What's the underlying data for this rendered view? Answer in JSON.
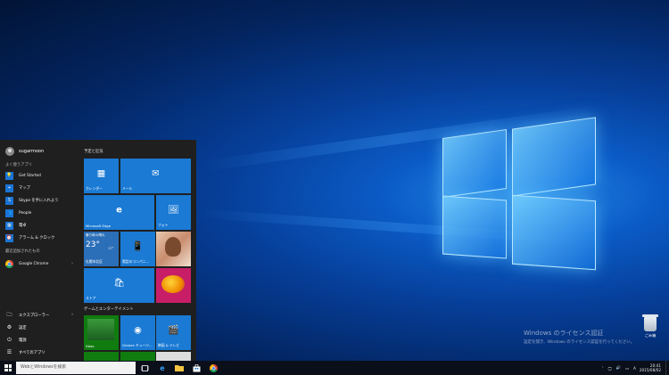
{
  "start_menu": {
    "user_name": "sugarmoon",
    "most_used_label": "よく使うアプリ",
    "most_used": [
      {
        "label": "Get Started",
        "icon": "lightbulb-icon",
        "glyph": "💡",
        "has_arrow": false
      },
      {
        "label": "マップ",
        "icon": "map-icon",
        "glyph": "⌖",
        "has_arrow": false
      },
      {
        "label": "Skype を手に入れよう",
        "icon": "skype-icon",
        "glyph": "S",
        "has_arrow": false
      },
      {
        "label": "People",
        "icon": "people-icon",
        "glyph": "👥",
        "has_arrow": false
      },
      {
        "label": "電卓",
        "icon": "calculator-icon",
        "glyph": "▦",
        "has_arrow": false
      },
      {
        "label": "アラーム & クロック",
        "icon": "alarm-icon",
        "glyph": "⏰",
        "has_arrow": false
      }
    ],
    "recent_label": "最近追加されたもの",
    "recent": [
      {
        "label": "Google Chrome",
        "icon": "chrome-icon",
        "has_arrow": true
      }
    ],
    "bottom": [
      {
        "label": "エクスプローラー",
        "icon": "explorer-icon",
        "glyph": "🗀",
        "has_arrow": true
      },
      {
        "label": "設定",
        "icon": "settings-icon",
        "glyph": "⚙",
        "has_arrow": false
      },
      {
        "label": "電源",
        "icon": "power-icon",
        "glyph": "⏻",
        "has_arrow": false
      },
      {
        "label": "すべてのアプリ",
        "icon": "all-apps-icon",
        "glyph": "☰",
        "has_arrow": false
      }
    ],
    "group1_title": "予定と近況",
    "group2_title": "ゲームとエンターテイメント",
    "tiles": {
      "calendar": "カレンダー",
      "mail": "メール",
      "edge": "Microsoft Edge",
      "photos": "フォト",
      "weather_header": "曇り時々晴れ",
      "weather_temp": "23°",
      "weather_low": "17°",
      "weather_city": "札幌市北区",
      "phone_companion": "電話のコンパニ...",
      "store": "ストア",
      "xbox": "Xbox",
      "groove": "Groove ミュージ...",
      "movies": "映画 & テレビ"
    }
  },
  "taskbar": {
    "search_placeholder": "WebとWindowsを検索",
    "ime": "A",
    "time": "20:41",
    "date": "2015/08/02"
  },
  "desktop": {
    "recycle_bin_label": "ごみ箱",
    "watermark_title": "Windows のライセンス認証",
    "watermark_text": "設定を開き、Windows のライセンス認証を行ってください。"
  },
  "colors": {
    "accent": "#1a7ad4",
    "start_bg": "#1f1f1f",
    "taskbar_bg": "#0a0f1a"
  }
}
